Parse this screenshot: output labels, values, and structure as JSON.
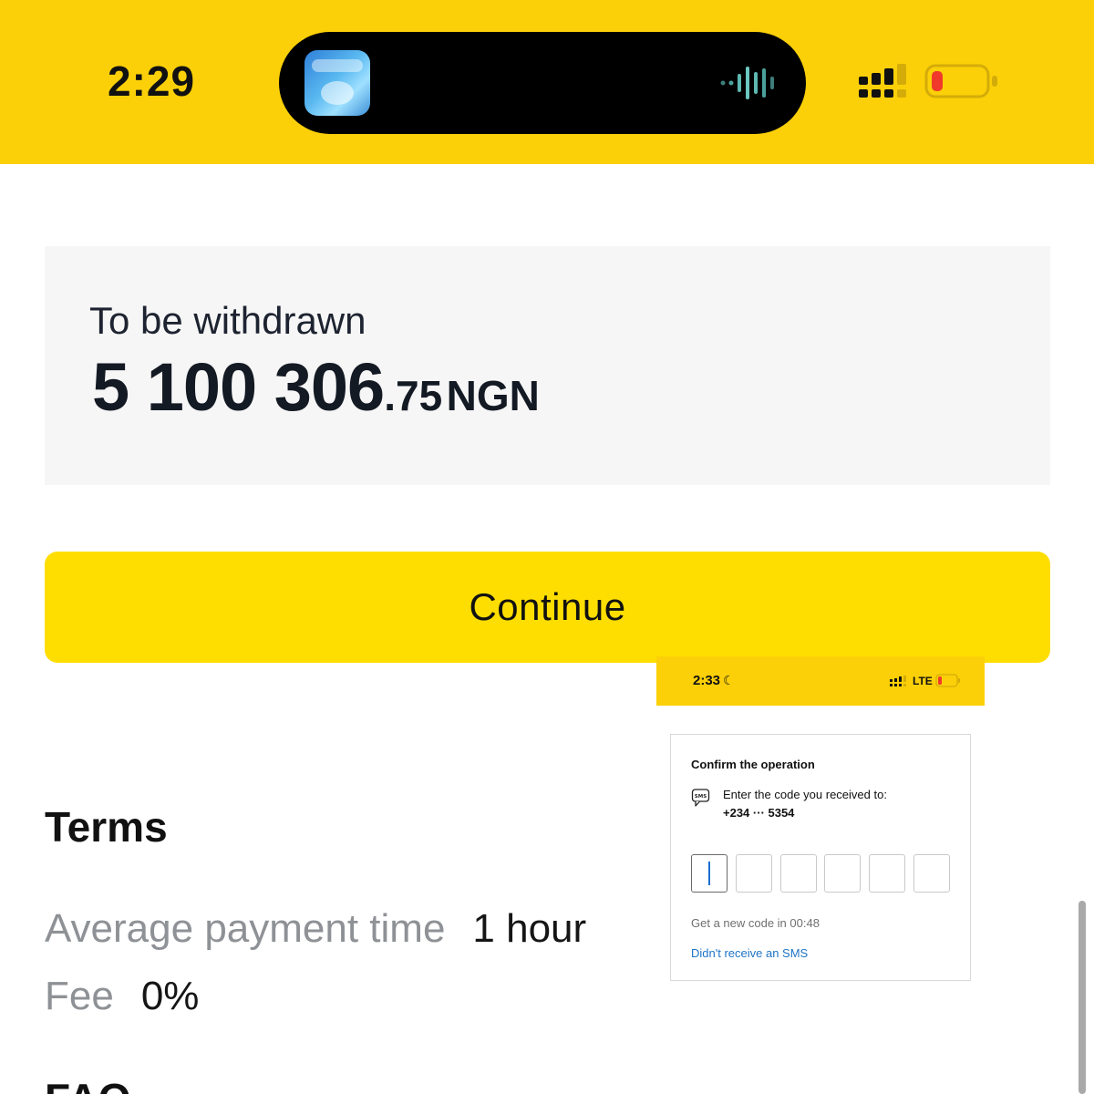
{
  "status_bar": {
    "time": "2:29",
    "island_app_icon": "lemonade-app-icon",
    "island_activity_icon": "audio-waveform-icon",
    "signal_icon": "cellular-signal-icon",
    "battery_icon": "battery-low-icon",
    "battery_level_fraction": 0.15,
    "colors": {
      "background": "#fbd008",
      "island": "#000000",
      "battery_low": "#f0392b"
    }
  },
  "withdraw_card": {
    "label": "To be withdrawn",
    "amount_integer": "5 100 306",
    "amount_decimal": ".75",
    "currency": "NGN"
  },
  "continue_button": {
    "label": "Continue",
    "color": "#fede00"
  },
  "terms": {
    "heading": "Terms",
    "rows": [
      {
        "key": "Average payment time",
        "value": "1 hour"
      },
      {
        "key": "Fee",
        "value": "0%"
      }
    ],
    "next_heading_partial": "FAQ"
  },
  "inset_screenshot": {
    "status_bar": {
      "time": "2:33",
      "moon_icon": "do-not-disturb-moon-icon",
      "signal_icon": "cellular-signal-icon",
      "network": "LTE",
      "battery_icon": "battery-low-icon"
    },
    "confirm": {
      "title": "Confirm the operation",
      "sms_icon": "sms-icon",
      "instruction": "Enter the code you received to:",
      "phone": "+234 ··· 5354",
      "code_boxes": [
        "",
        "",
        "",
        "",
        "",
        ""
      ],
      "resend_timer": "Get a new code in 00:48",
      "sms_link": "Didn't receive an SMS",
      "link_color": "#1f74c4"
    }
  }
}
